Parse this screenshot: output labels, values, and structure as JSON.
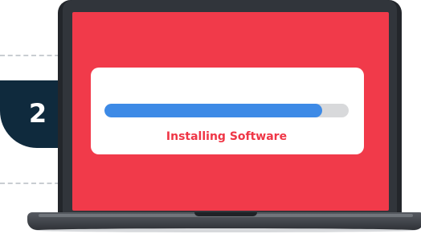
{
  "step": {
    "number": "2"
  },
  "installer": {
    "status_text": "Installing Software",
    "progress_percent": 89
  },
  "colors": {
    "screen_background": "#f13a4a",
    "progress_fill": "#3d8ae6",
    "progress_track": "#d8d9db",
    "status_text": "#ef3646",
    "badge_background": "#0f2a3d"
  },
  "icons": {
    "device": "laptop-icon"
  }
}
